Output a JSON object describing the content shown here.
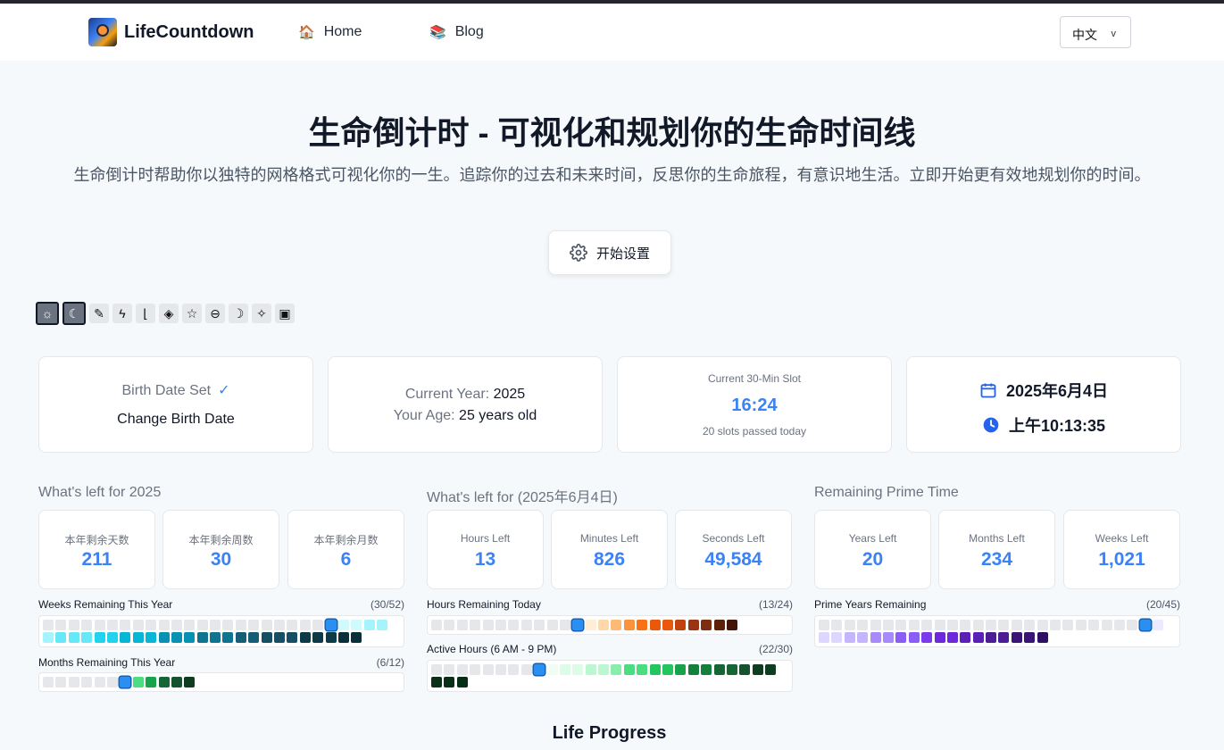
{
  "nav": {
    "brand": "LifeCountdown",
    "links": [
      {
        "icon": "house-icon",
        "glyph": "🏠",
        "label": "Home"
      },
      {
        "icon": "books-icon",
        "glyph": "📚",
        "label": "Blog"
      }
    ],
    "language": "中文"
  },
  "hero": {
    "title": "生命倒计时 - 可视化和规划你的生命时间线",
    "subtitle": "生命倒计时帮助你以独特的网格格式可视化你的一生。追踪你的过去和未来时间，反思你的生命旅程，有意识地生活。立即开始更有效地规划你的时间。",
    "setup_label": "开始设置"
  },
  "themes": [
    {
      "name": "sun-theme-icon",
      "glyph": "☼"
    },
    {
      "name": "moon-theme-icon",
      "glyph": "☾"
    },
    {
      "name": "brush-theme-icon",
      "glyph": "✎"
    },
    {
      "name": "lightning-theme-icon",
      "glyph": "ϟ"
    },
    {
      "name": "feather-theme-icon",
      "glyph": "⌊"
    },
    {
      "name": "ticket-theme-icon",
      "glyph": "◈"
    },
    {
      "name": "star-theme-icon",
      "glyph": "☆"
    },
    {
      "name": "minus-circle-theme-icon",
      "glyph": "⊖"
    },
    {
      "name": "crescent-theme-icon",
      "glyph": "☽"
    },
    {
      "name": "sparkles-theme-icon",
      "glyph": "✧"
    },
    {
      "name": "chip-theme-icon",
      "glyph": "▣"
    }
  ],
  "cards": {
    "birth": {
      "status": "Birth Date Set",
      "check": "✓",
      "action": "Change Birth Date"
    },
    "year": {
      "year_label": "Current Year:",
      "year": "2025",
      "age_label": "Your Age:",
      "age": "25 years old"
    },
    "slot": {
      "label": "Current 30-Min Slot",
      "time": "16:24",
      "note": "20 slots passed today"
    },
    "date": {
      "date": "2025年6月4日",
      "time": "上午10:13:35"
    }
  },
  "sections": {
    "year": {
      "title": "What's left for 2025",
      "stats": [
        {
          "label": "本年剩余天数",
          "value": "211"
        },
        {
          "label": "本年剩余周数",
          "value": "30"
        },
        {
          "label": "本年剩余月数",
          "value": "6"
        }
      ]
    },
    "day": {
      "title": "What's left for (2025年6月4日)",
      "stats": [
        {
          "label": "Hours Left",
          "value": "13"
        },
        {
          "label": "Minutes Left",
          "value": "826"
        },
        {
          "label": "Seconds Left",
          "value": "49,584"
        }
      ]
    },
    "prime": {
      "title": "Remaining Prime Time",
      "stats": [
        {
          "label": "Years Left",
          "value": "20"
        },
        {
          "label": "Months Left",
          "value": "234"
        },
        {
          "label": "Weeks Left",
          "value": "1,021"
        }
      ]
    }
  },
  "grids": {
    "weeks": {
      "title": "Weeks Remaining This Year",
      "count": "(30/52)",
      "total": 52,
      "passed": 22,
      "colors": [
        "#cffafe",
        "#a5f3fc",
        "#67e8f9",
        "#22d3ee",
        "#06b6d4",
        "#0891b2",
        "#0e7490",
        "#155e75",
        "#164e63",
        "#0c3a47",
        "#082f3a"
      ]
    },
    "months": {
      "title": "Months Remaining This Year",
      "count": "(6/12)",
      "total": 12,
      "passed": 6,
      "colors": [
        "#4ade80",
        "#16a34a",
        "#166534",
        "#14532d",
        "#0b3d1e"
      ]
    },
    "hours": {
      "title": "Hours Remaining Today",
      "count": "(13/24)",
      "total": 24,
      "passed": 11,
      "colors": [
        "#ffedd5",
        "#fed7aa",
        "#fdba74",
        "#fb923c",
        "#f97316",
        "#ea580c",
        "#c2410c",
        "#9a3412",
        "#7c2d12",
        "#5c1f0a",
        "#431407"
      ]
    },
    "active": {
      "title": "Active Hours (6 AM - 9 PM)",
      "count": "(22/30)",
      "total": 30,
      "passed": 8,
      "colors": [
        "#f0fdf4",
        "#dcfce7",
        "#bbf7d0",
        "#86efac",
        "#4ade80",
        "#22c55e",
        "#16a34a",
        "#15803d",
        "#166534",
        "#14532d",
        "#0f3d20",
        "#0b2e18",
        "#052e16"
      ]
    },
    "prime": {
      "title": "Prime Years Remaining",
      "count": "(20/45)",
      "total": 45,
      "passed": 25,
      "colors": [
        "#ede9fe",
        "#ddd6fe",
        "#c4b5fd",
        "#a78bfa",
        "#8b5cf6",
        "#7c3aed",
        "#6d28d9",
        "#5b21b6",
        "#4c1d95",
        "#3b1576",
        "#2e1065"
      ]
    }
  },
  "life": {
    "title": "Life Progress"
  }
}
